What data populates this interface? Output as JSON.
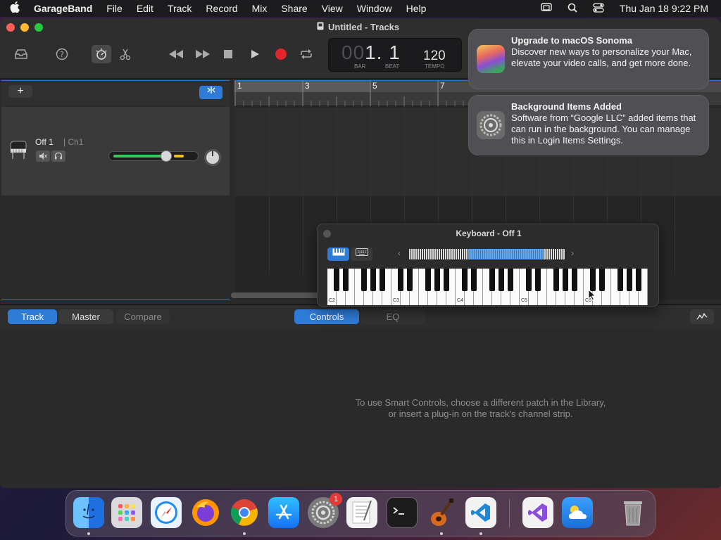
{
  "menubar": {
    "apple": "",
    "app_name": "GarageBand",
    "items": [
      "File",
      "Edit",
      "Track",
      "Record",
      "Mix",
      "Share",
      "View",
      "Window",
      "Help"
    ],
    "datetime": "Thu Jan 18  9:22 PM"
  },
  "window": {
    "title": "Untitled - Tracks"
  },
  "lcd": {
    "position_dim": "00",
    "position": "1. 1",
    "bar_label": "BAR",
    "beat_label": "BEAT",
    "tempo": "120",
    "tempo_label": "TEMPO"
  },
  "track": {
    "name": "Off 1",
    "channel": "| Ch1",
    "volume": 0.82
  },
  "ruler": {
    "bars": [
      "1",
      "3",
      "5",
      "7"
    ]
  },
  "bottom": {
    "tabs_left": [
      "Track",
      "Master",
      "Compare"
    ],
    "tabs_right": [
      "Controls",
      "EQ"
    ],
    "message_line1": "To use Smart Controls, choose a different patch in the Library,",
    "message_line2": "or insert a plug-in on the track's channel strip."
  },
  "notifications": [
    {
      "title": "Upgrade to macOS Sonoma",
      "body": "Discover new ways to personalize your Mac, elevate your video calls, and get more done."
    },
    {
      "title": "Background Items Added",
      "body": "Software from “Google LLC” added items that can run in the background. You can manage this in Login Items Settings."
    }
  ],
  "keyboard": {
    "title": "Keyboard - Off 1",
    "labels": [
      "C2",
      "C3",
      "C4",
      "C5",
      "C6"
    ]
  },
  "dock": {
    "apps": [
      "Finder",
      "Launchpad",
      "Safari",
      "Firefox",
      "Chrome",
      "App Store",
      "System Settings",
      "TextEdit",
      "Terminal",
      "GarageBand",
      "Visual Studio Code",
      "Visual Studio",
      "Weather",
      "Trash"
    ],
    "settings_badge": "1"
  },
  "colors": {
    "accent": "#2f7bd8",
    "record": "#e0262b",
    "volume": "#3cc85a"
  }
}
